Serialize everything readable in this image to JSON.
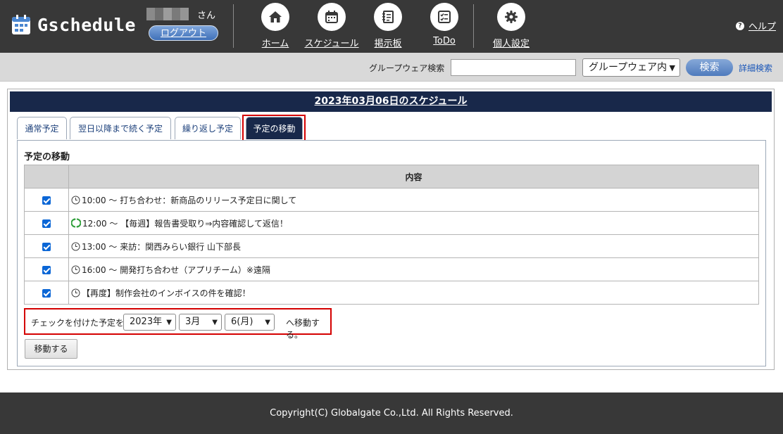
{
  "app": {
    "title": "Gschedule"
  },
  "user": {
    "suffix": "さん",
    "logout_label": "ログアウト"
  },
  "nav": {
    "items": [
      {
        "label": "ホーム",
        "icon": "home-icon"
      },
      {
        "label": "スケジュール",
        "icon": "calendar-icon"
      },
      {
        "label": "掲示板",
        "icon": "notepad-icon"
      },
      {
        "label": "ToDo",
        "icon": "checklist-icon"
      },
      {
        "label": "個人設定",
        "icon": "gear-icon"
      }
    ],
    "help_label": "ヘルプ"
  },
  "search": {
    "label": "グループウェア検索",
    "value": "",
    "scope_selected": "グループウェア内",
    "button_label": "検索",
    "advanced_label": "詳細検索"
  },
  "schedule": {
    "date_title": "2023年03月06日のスケジュール",
    "tabs": [
      {
        "label": "通常予定",
        "active": false
      },
      {
        "label": "翌日以降まで続く予定",
        "active": false
      },
      {
        "label": "繰り返し予定",
        "active": false
      },
      {
        "label": "予定の移動",
        "active": true
      }
    ],
    "section_title": "予定の移動",
    "table_header": "内容",
    "items": [
      {
        "checked": true,
        "icon": "clock-icon",
        "text": "10:00 ～ 打ち合わせ：新商品のリリース予定日に関して"
      },
      {
        "checked": true,
        "icon": "repeat-icon",
        "text": "12:00 ～ 【毎週】報告書受取り⇒内容確認して返信！"
      },
      {
        "checked": true,
        "icon": "clock-icon",
        "text": "13:00 ～ 来訪：関西みらい銀行 山下部長"
      },
      {
        "checked": true,
        "icon": "clock-icon",
        "text": "16:00 ～ 開発打ち合わせ（アプリチーム）※遠隔"
      },
      {
        "checked": true,
        "icon": "clock-icon",
        "text": " 【再度】制作会社のインボイスの件を確認！"
      }
    ],
    "move": {
      "label": "チェックを付けた予定を",
      "year": "2023年",
      "month": "3月",
      "day": "6(月)",
      "suffix": "へ移動する。",
      "button_label": "移動する"
    }
  },
  "footer": {
    "copyright": "Copyright(C) Globalgate Co.,Ltd. All Rights Reserved."
  },
  "colors": {
    "header_bg": "#383838",
    "navy": "#18284a",
    "highlight": "#d40000",
    "button_blue": "#4f7bbd"
  }
}
